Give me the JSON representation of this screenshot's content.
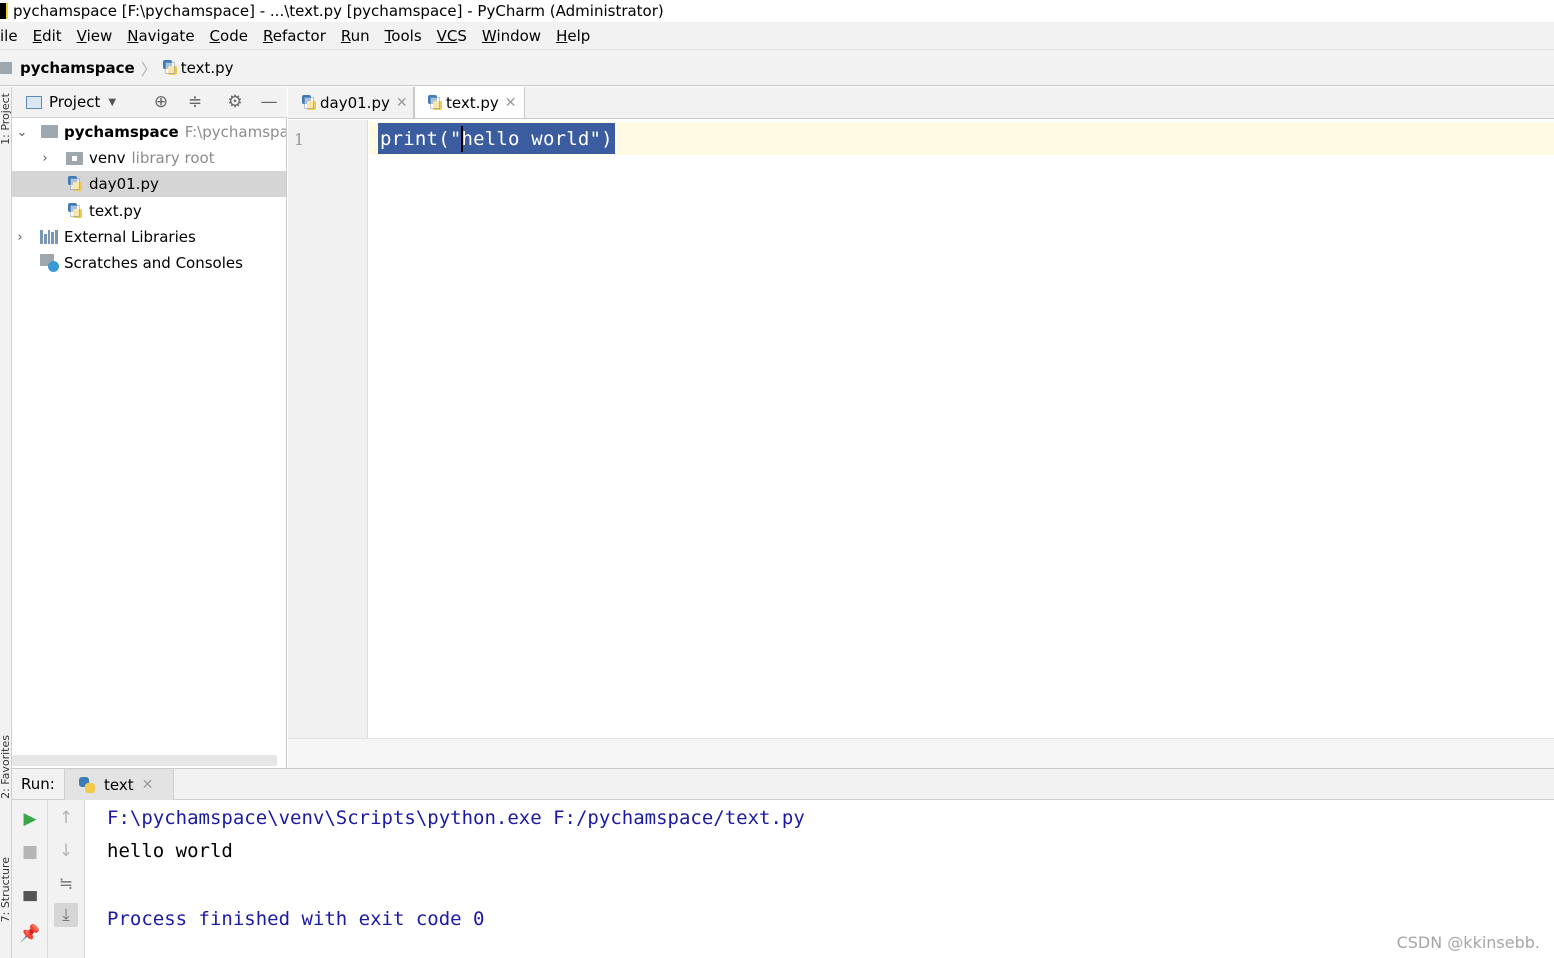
{
  "window": {
    "title": "pychamspace [F:\\pychamspace] - ...\\text.py [pychamspace] - PyCharm (Administrator)"
  },
  "menu": {
    "items": [
      {
        "pre": "F",
        "mn": "",
        "post": "ile"
      },
      {
        "pre": "",
        "mn": "E",
        "post": "dit"
      },
      {
        "pre": "",
        "mn": "V",
        "post": "iew"
      },
      {
        "pre": "",
        "mn": "N",
        "post": "avigate"
      },
      {
        "pre": "",
        "mn": "C",
        "post": "ode"
      },
      {
        "pre": "",
        "mn": "R",
        "post": "efactor"
      },
      {
        "pre": "",
        "mn": "R",
        "post": "un"
      },
      {
        "pre": "",
        "mn": "T",
        "post": "ools"
      },
      {
        "pre": "",
        "mn": "VC",
        "post": "S"
      },
      {
        "pre": "",
        "mn": "W",
        "post": "indow"
      },
      {
        "pre": "",
        "mn": "H",
        "post": "elp"
      }
    ]
  },
  "navbar": {
    "project": "pychamspace",
    "file": "text.py"
  },
  "side_strip": {
    "top_label": "1: Project",
    "mid_label": "2: Favorites",
    "bottom_label": "7: Structure"
  },
  "project_panel": {
    "view_label": "Project",
    "tree": {
      "root_name": "pychamspace",
      "root_path": "F:\\pychamspace",
      "venv_name": "venv",
      "venv_hint": "library root",
      "file1": "day01.py",
      "file2": "text.py",
      "ext_libs": "External Libraries",
      "scratches": "Scratches and Consoles"
    }
  },
  "editor": {
    "tabs": [
      {
        "label": "day01.py",
        "active": false
      },
      {
        "label": "text.py",
        "active": true
      }
    ],
    "line_number": "1",
    "code": "print(\"hello world\")"
  },
  "run": {
    "label": "Run:",
    "tab_label": "text",
    "console": {
      "cmd": "F:\\pychamspace\\venv\\Scripts\\python.exe F:/pychamspace/text.py",
      "output": "hello world",
      "exit": "Process finished with exit code 0"
    }
  },
  "watermark": "CSDN @kkinsebb.",
  "colors": {
    "selection": "#3b5c9e",
    "current_line": "#fffae3",
    "console_system": "#1a1aa6",
    "run_green": "#3aa64a"
  }
}
